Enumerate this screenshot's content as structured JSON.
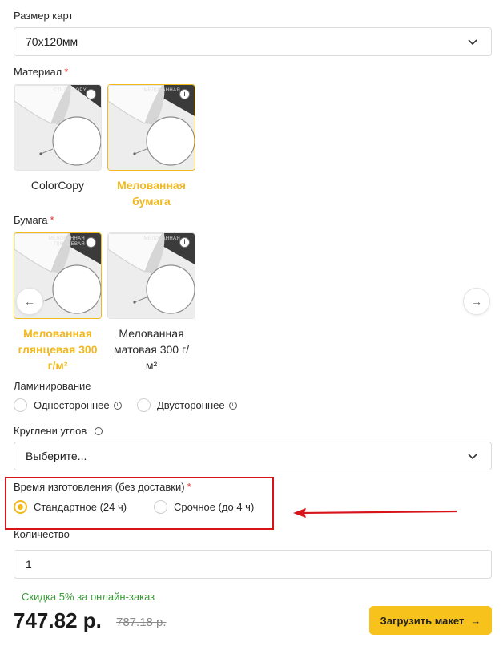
{
  "card_size": {
    "label": "Размер карт",
    "value": "70x120мм"
  },
  "material": {
    "label": "Материал",
    "required_mark": "*",
    "options": [
      {
        "name": "ColorCopy",
        "thumb_text": "COLORCOPY",
        "selected": false
      },
      {
        "name": "Мелованная бумага",
        "thumb_text": "МЕЛОВАННАЯ",
        "selected": true
      }
    ]
  },
  "paper": {
    "label": "Бумага",
    "required_mark": "*",
    "options": [
      {
        "name": "Мелованная глянцевая 300 г/м²",
        "thumb_text": "МЕЛОВАННАЯ ГЛЯНЦЕВАЯ",
        "selected": true
      },
      {
        "name": "Мелованная матовая 300 г/ м²",
        "thumb_text": "МЕЛОВАННАЯ",
        "selected": false
      }
    ],
    "prev_icon": "←",
    "next_icon": "→"
  },
  "lamination": {
    "label": "Ламинирование",
    "options": [
      {
        "label": "Одностороннее",
        "selected": false
      },
      {
        "label": "Двустороннее",
        "selected": false
      }
    ]
  },
  "rounding": {
    "label": "Круглени углов",
    "placeholder": "Выберите..."
  },
  "production_time": {
    "label": "Время изготовления (без доставки)",
    "required_mark": "*",
    "options": [
      {
        "label": "Стандартное (24 ч)",
        "selected": true
      },
      {
        "label": "Срочное (до 4 ч)",
        "selected": false
      }
    ]
  },
  "quantity": {
    "label": "Количество",
    "value": "1"
  },
  "discount_text": "Скидка 5% за онлайн-заказ",
  "price": "747.82 р.",
  "old_price": "787.18 р.",
  "upload_button": {
    "label": "Загрузить макет",
    "icon": "→"
  },
  "info_glyph": "i",
  "colors": {
    "accent": "#f7c21c",
    "selected_text": "#f2b81d",
    "discount": "#3a9a3a",
    "annotation": "#d8141b"
  }
}
